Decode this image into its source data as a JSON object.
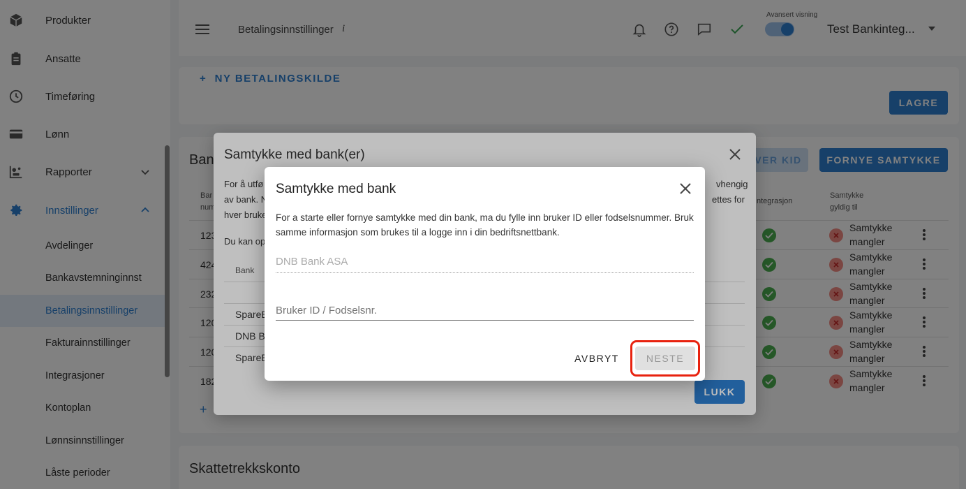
{
  "sidebar": {
    "items": [
      {
        "label": "Produkter",
        "icon": "box-icon"
      },
      {
        "label": "Ansatte",
        "icon": "badge-icon"
      },
      {
        "label": "Timeføring",
        "icon": "clock-icon"
      },
      {
        "label": "Lønn",
        "icon": "credit-card-icon"
      },
      {
        "label": "Rapporter",
        "icon": "report-icon"
      },
      {
        "label": "Innstillinger",
        "icon": "gear-icon"
      }
    ],
    "sub_items": [
      "Avdelinger",
      "Bankavstemninginnst",
      "Betalingsinnstillinger",
      "Fakturainnstillinger",
      "Integrasjoner",
      "Kontoplan",
      "Lønnsinnstillinger",
      "Låste perioder"
    ],
    "active_sub": "Betalingsinnstillinger"
  },
  "topbar": {
    "page_title": "Betalingsinnstillinger",
    "info": "i",
    "advanced_label": "Avansert visning",
    "company": "Test Bankinteg..."
  },
  "payment": {
    "new_source": "NY BETALINGSKILDE",
    "save": "LAGRE"
  },
  "bank_section": {
    "title_partial": "Ban",
    "kid_partial": "VER KID",
    "renew": "FORNYE SAMTYKKE",
    "col_account_1": "Bar",
    "col_account_2": "num",
    "col_integration": "ntegrasjon",
    "col_consent_1": "Samtykke",
    "col_consent_2": "gyldig til",
    "rows": [
      {
        "num": "123",
        "status_1": "Samtykke",
        "status_2": "mangler"
      },
      {
        "num": "424",
        "status_1": "Samtykke",
        "status_2": "mangler"
      },
      {
        "num": "232",
        "status_1": "Samtykke",
        "status_2": "mangler"
      },
      {
        "num": "120",
        "status_1": "Samtykke",
        "status_2": "mangler"
      },
      {
        "num": "120",
        "status_1": "Samtykke",
        "status_2": "mangler"
      },
      {
        "num": "182",
        "status_1": "Samtykke",
        "status_2": "mangler"
      }
    ]
  },
  "tax_section": {
    "title": "Skattetrekkskonto"
  },
  "dialog1": {
    "title": "Samtykke med bank(er)",
    "line1_left": "For å utfø",
    "line1_right": "vhengig",
    "line2_left": "av bank. N",
    "line2_right": "ettes for",
    "line3_left": "hver bruke",
    "line4_left": "Du kan op",
    "bank_header": "Bank",
    "banks": [
      "SpareB",
      "DNB B",
      "SpareB"
    ],
    "close": "LUKK"
  },
  "dialog2": {
    "title": "Samtykke med bank",
    "description": "For a starte eller fornye samtykke med din bank, ma du fylle inn bruker ID eller fodselsnummer. Bruk samme informasjon som brukes til a logge inn i din bedriftsnettbank.",
    "bank_value": "DNB Bank ASA",
    "user_placeholder": "Bruker ID / Fodselsnr.",
    "cancel": "AVBRYT",
    "next": "NESTE"
  }
}
